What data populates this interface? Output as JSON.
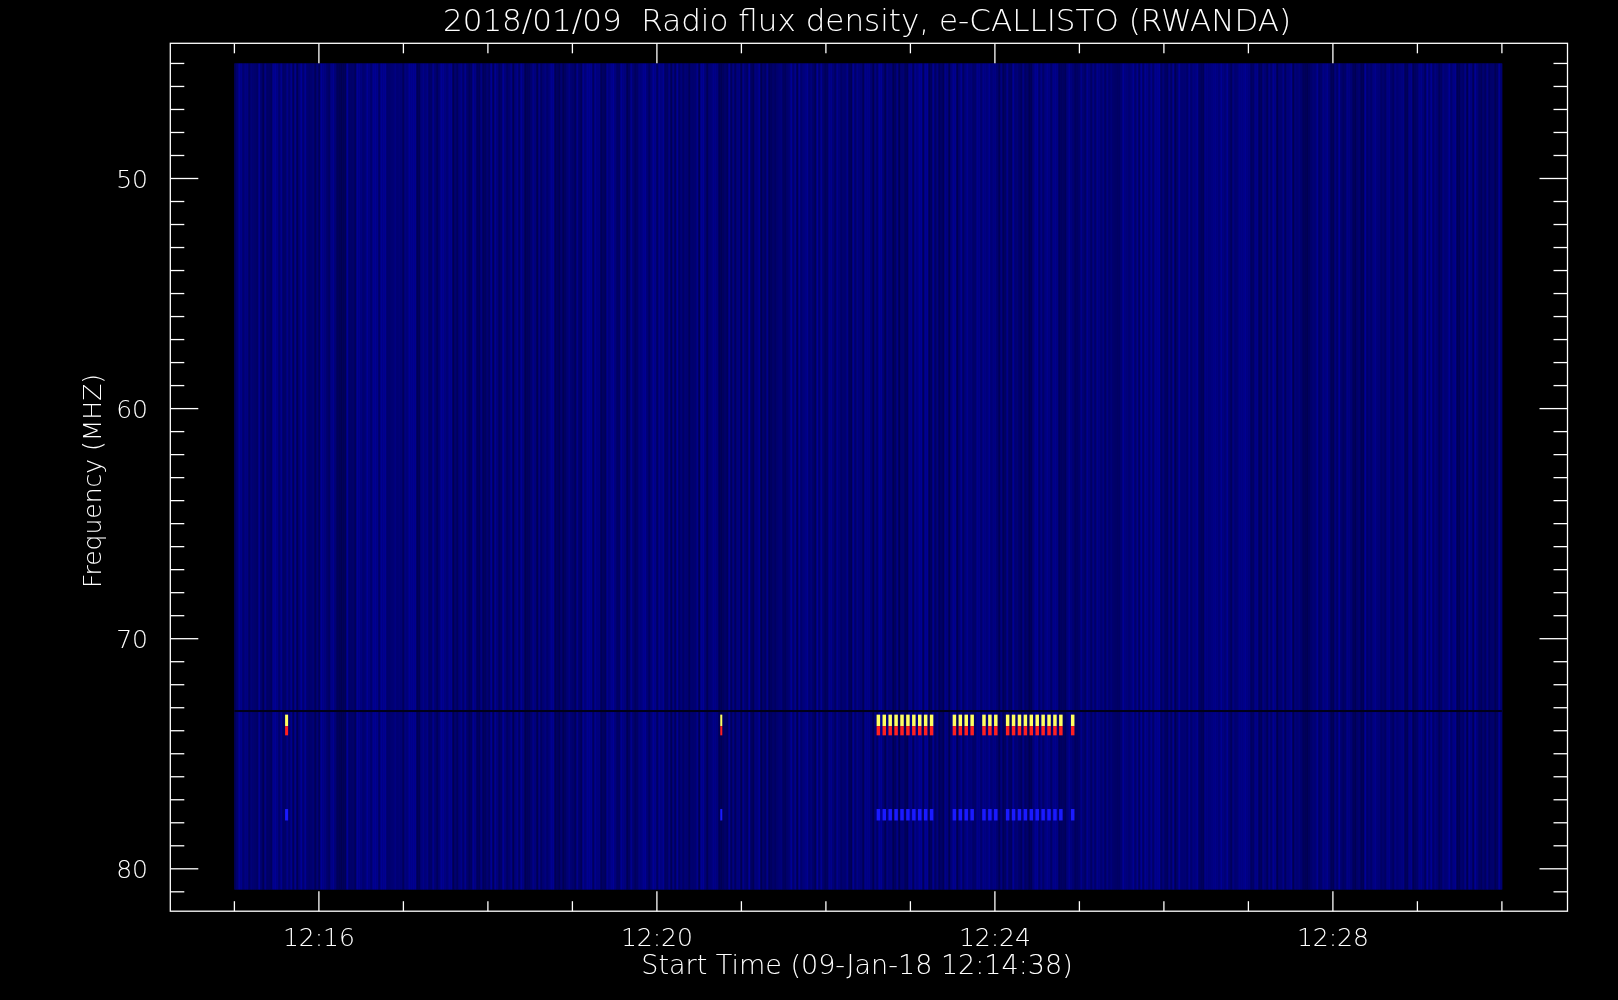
{
  "title": "2018/01/09  Radio flux density, e-CALLISTO (RWANDA)",
  "xlabel": "Start Time (09-Jan-18 12:14:38)",
  "ylabel": "Frequency (MHZ)",
  "xticks": [
    "12:16",
    "12:20",
    "12:24",
    "12:28"
  ],
  "yticks": [
    "50",
    "60",
    "70",
    "80"
  ]
}
